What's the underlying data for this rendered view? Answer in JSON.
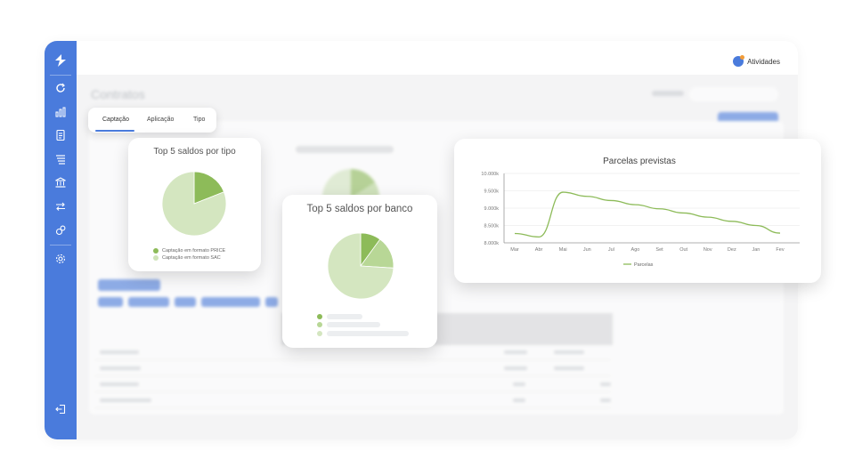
{
  "header": {
    "activity_label": "Atividades"
  },
  "page": {
    "title": "Contratos"
  },
  "tabs": [
    "Captação",
    "Aplicação",
    "Tipo"
  ],
  "card_tipo": {
    "title": "Top 5 saldos por tipo",
    "legend": [
      {
        "label": "Captação em formato PRICE",
        "color": "#8dbb59"
      },
      {
        "label": "Captação em formato SAC",
        "color": "#cfe3b8"
      }
    ],
    "slices": [
      {
        "label": "Captação em formato PRICE",
        "percent": 19,
        "color": "#8dbb59"
      },
      {
        "label": "Captação em formato SAC",
        "percent": 81,
        "color": "#d4e6c0"
      }
    ]
  },
  "card_banco": {
    "title": "Top 5 saldos por banco",
    "slices": [
      {
        "percent": 10,
        "color": "#8dbb59"
      },
      {
        "percent": 16,
        "color": "#b8d796"
      },
      {
        "percent": 74,
        "color": "#d4e6c0"
      }
    ],
    "legend_colors": [
      "#8dbb59",
      "#b8d796",
      "#d4e6c0"
    ]
  },
  "chart_data": {
    "type": "line",
    "title": "Parcelas previstas",
    "categories": [
      "Mar",
      "Abr",
      "Mai",
      "Jun",
      "Jul",
      "Ago",
      "Set",
      "Out",
      "Nov",
      "Dez",
      "Jan",
      "Fev"
    ],
    "ytick_labels": [
      "10.000k",
      "9.500k",
      "9.000k",
      "8.500k",
      "8.000k"
    ],
    "ylim": [
      8000,
      10000
    ],
    "series": [
      {
        "name": "Parcelas",
        "values": [
          8270,
          8170,
          9460,
          9340,
          9220,
          9100,
          8980,
          8860,
          8740,
          8620,
          8500,
          8280
        ],
        "color": "#8dbb59"
      }
    ],
    "legend_position": "bottom",
    "grid": true
  },
  "colors": {
    "accent": "#4a7bdc",
    "chart_green": "#8dbb59"
  }
}
